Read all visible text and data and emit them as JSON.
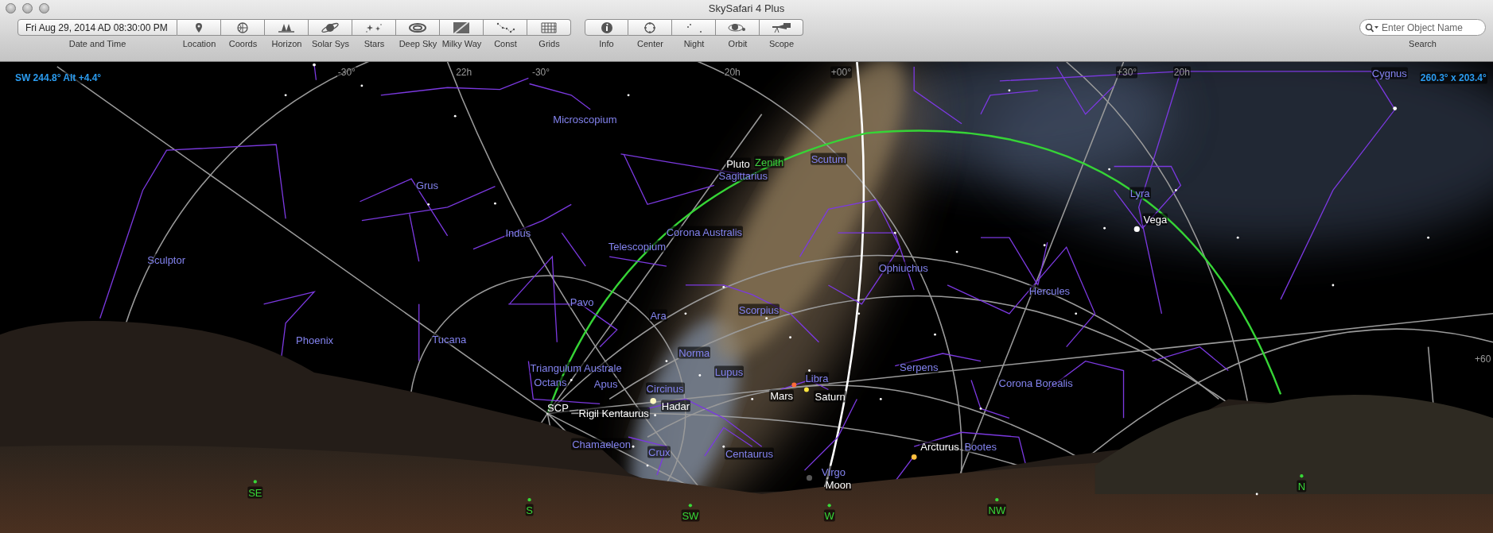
{
  "window": {
    "title": "SkySafari 4 Plus"
  },
  "toolbar": {
    "date_time": {
      "value": "Fri Aug 29, 2014 AD 08:30:00 PM",
      "label": "Date and Time"
    },
    "view_buttons": [
      {
        "label": "Location",
        "kind": "location"
      },
      {
        "label": "Coords",
        "kind": "coords"
      },
      {
        "label": "Horizon",
        "kind": "horizon"
      },
      {
        "label": "Solar Sys",
        "kind": "planet"
      },
      {
        "label": "Stars",
        "kind": "stars"
      },
      {
        "label": "Deep Sky",
        "kind": "galaxy"
      },
      {
        "label": "Milky Way",
        "kind": "milkyway"
      },
      {
        "label": "Const",
        "kind": "constellation"
      },
      {
        "label": "Grids",
        "kind": "grid"
      }
    ],
    "action_buttons": [
      {
        "label": "Info",
        "kind": "info"
      },
      {
        "label": "Center",
        "kind": "center"
      },
      {
        "label": "Night",
        "kind": "night"
      },
      {
        "label": "Orbit",
        "kind": "orbit"
      },
      {
        "label": "Scope",
        "kind": "scope"
      }
    ],
    "search": {
      "placeholder": "Enter Object Name",
      "label": "Search"
    }
  },
  "sky": {
    "readouts": [
      "SW 244.8° Alt +4.4°",
      "260.3° x 203.4°"
    ],
    "grid_labels": [
      "-30°",
      "22h",
      "-30°",
      "20h",
      "+00°",
      "+30°",
      "20h",
      "+60"
    ],
    "constellations": [
      "Microscopium",
      "Grus",
      "Indus",
      "Sculptor",
      "Telescopium",
      "Corona Australis",
      "Sagittarius",
      "Scutum",
      "Pavo",
      "Ara",
      "Phoenix",
      "Tucana",
      "Triangulum Australe",
      "Octans",
      "Apus",
      "Norma",
      "Circinus",
      "Lupus",
      "Scorpius",
      "Ophiuchus",
      "Hercules",
      "Lyra",
      "Cygnus",
      "Serpens",
      "Corona Borealis",
      "Libra",
      "Bootes",
      "Virgo",
      "Centaurus",
      "Crux",
      "Chamaeleon"
    ],
    "objects": [
      "Pluto",
      "Vega",
      "SCP",
      "Rigil Kentaurus",
      "Hadar",
      "Mars",
      "Saturn",
      "Arcturus",
      "Moon"
    ],
    "zenith": "Zenith",
    "directions": [
      "SE",
      "S",
      "SW",
      "W",
      "NW",
      "N"
    ]
  }
}
